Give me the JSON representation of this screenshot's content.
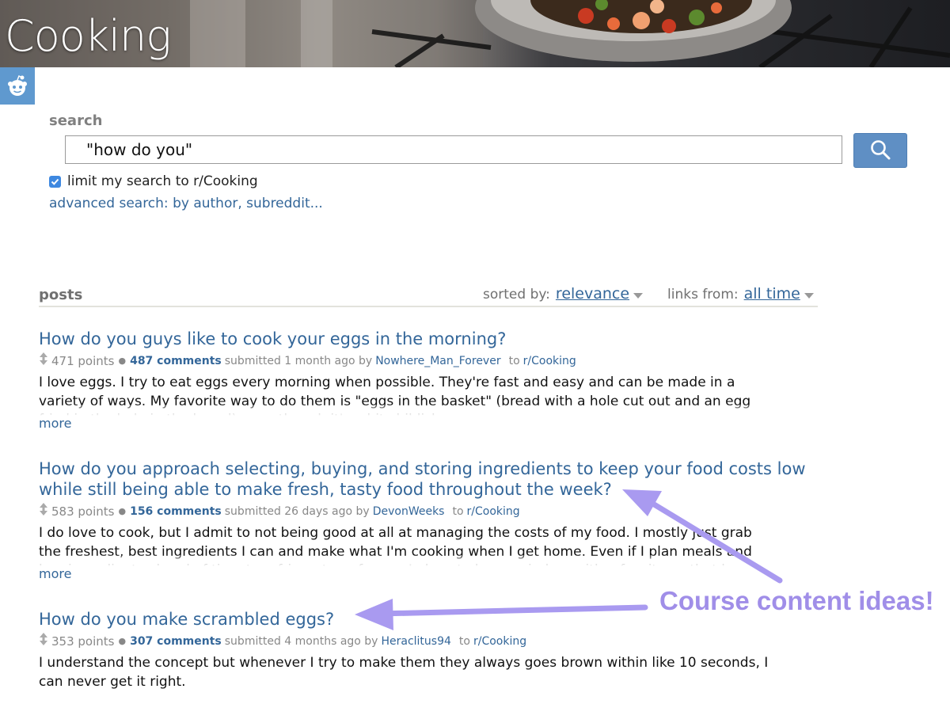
{
  "banner": {
    "title": "Cooking"
  },
  "search": {
    "label": "search",
    "query": "\"how do you\"",
    "limit_checked": true,
    "limit_label": "limit my search to r/Cooking",
    "advanced_link": "advanced search: by author, subreddit..."
  },
  "posts_header": {
    "label": "posts",
    "sorted_by_label": "sorted by:",
    "sorted_by_value": "relevance",
    "links_from_label": "links from:",
    "links_from_value": "all time"
  },
  "results": [
    {
      "title": "How do you guys like to cook your eggs in the morning?",
      "points": "471 points",
      "comments": "487 comments",
      "submitted": "submitted 1 month ago by",
      "author": "Nowhere_Man_Forever",
      "to": "to",
      "subreddit": "r/Cooking",
      "excerpt": "I love eggs. I try to eat eggs every morning when possible. They're fast and easy and can be made in a variety of ways. My favorite way to do them is \"eggs in the basket\" (bread with a hole cut out and an egg fried in the hole in the bread) even though it's a bit childish",
      "more": "more"
    },
    {
      "title": "How do you approach selecting, buying, and storing ingredients to keep your food costs low while still being able to make fresh, tasty food throughout the week?",
      "points": "583 points",
      "comments": "156 comments",
      "submitted": "submitted 26 days ago by",
      "author": "DevonWeeks",
      "to": "to",
      "subreddit": "r/Cooking",
      "excerpt": "I do love to cook, but I admit to not being good at all at managing the costs of my food. I mostly just grab the freshest, best ingredients I can and make what I'm cooking when I get home. Even if I plan meals and buy ingredients ahead of time to refrigerate or freeze, I almost always wind up with a few items that be",
      "more": "more"
    },
    {
      "title": "How do you make scrambled eggs?",
      "points": "353 points",
      "comments": "307 comments",
      "submitted": "submitted 4 months ago by",
      "author": "Heraclitus94",
      "to": "to",
      "subreddit": "r/Cooking",
      "excerpt": "I understand the concept but whenever I try to make them they always goes brown within like 10 seconds, I can never get it right."
    }
  ],
  "annotation": {
    "text": "Course content ideas!",
    "color": "#a08ee8"
  },
  "colors": {
    "link": "#336699",
    "search_button": "#5f8fc4",
    "reddit_badge": "#5f99cf",
    "checkbox": "#3e88e0"
  },
  "icons": {
    "badge": "reddit-alien-icon",
    "search": "magnifier-icon",
    "vote": "updown-arrow-icon",
    "dropdown": "caret-down-icon"
  }
}
